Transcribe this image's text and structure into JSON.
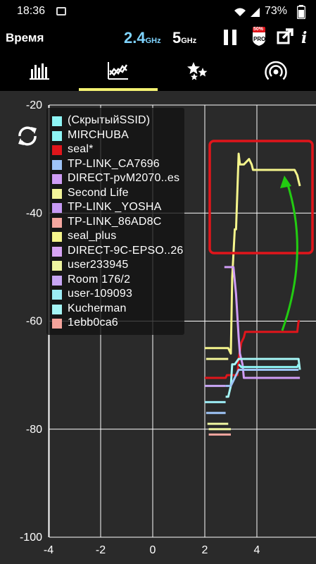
{
  "status_bar": {
    "time": "18:36",
    "battery": "73%"
  },
  "app_bar": {
    "title": "Время",
    "band_24": "2.4",
    "band_24_unit": "GHz",
    "band_5": "5",
    "band_5_unit": "GHz",
    "pro_badge": "PRO",
    "discount": "50%",
    "info": "i"
  },
  "tabs": [
    {
      "name": "channel-rating",
      "icon": "bar-chart-icon",
      "active": false
    },
    {
      "name": "time-graph",
      "icon": "time-graph-icon",
      "active": true
    },
    {
      "name": "channel-stars",
      "icon": "stars-icon",
      "active": false
    },
    {
      "name": "signal-meter",
      "icon": "signal-meter-icon",
      "active": false
    }
  ],
  "colors": {
    "accent_yellow": "#f3f171",
    "band_active": "#7fd4ff",
    "annotation_red": "#e0151b",
    "annotation_green": "#22cc11",
    "grid": "#ffffff",
    "background": "#2a2a2a"
  },
  "chart_data": {
    "type": "line",
    "xlabel": "",
    "ylabel": "",
    "xlim": [
      -4.8,
      5.8
    ],
    "ylim": [
      -100,
      -20
    ],
    "x_ticks": [
      "-4",
      "-2",
      "0",
      "2",
      "4"
    ],
    "y_ticks": [
      "-20",
      "-40",
      "-60",
      "-80",
      "-100"
    ],
    "grid": true,
    "legend_placement": "top-left",
    "legend": [
      {
        "name": "(СкрытыйSSID)",
        "color": "#8ef5f5"
      },
      {
        "name": "MIRCHUBA",
        "color": "#8ef5f5"
      },
      {
        "name": "seal*",
        "color": "#e0151b"
      },
      {
        "name": "TP-LINK_CA7696",
        "color": "#9ec4f7"
      },
      {
        "name": "DIRECT-pvM2070..es",
        "color": "#cf9cf5"
      },
      {
        "name": "Second Life",
        "color": "#f3f59a"
      },
      {
        "name": "TP-LINK _YOSHA",
        "color": "#c79af5"
      },
      {
        "name": "TP-LINK_86AD8C",
        "color": "#f5a7a0"
      },
      {
        "name": "seal_plus",
        "color": "#f5f58c"
      },
      {
        "name": "DIRECT-9C-EPSO..26",
        "color": "#d7a4f5"
      },
      {
        "name": "user233945",
        "color": "#eef5a0"
      },
      {
        "name": "Room 176/2",
        "color": "#c8a6f5"
      },
      {
        "name": "user-109093",
        "color": "#9cecf5"
      },
      {
        "name": "Kucherman",
        "color": "#a5f5f5"
      },
      {
        "name": "1ebb0ca6",
        "color": "#f5a49c"
      }
    ],
    "series": [
      {
        "color": "#f5f58c",
        "x": [
          2.0,
          2.9,
          3.0,
          3.05,
          3.15,
          3.2,
          3.3,
          3.35,
          3.5,
          3.7,
          3.8,
          3.85,
          5.0,
          5.3,
          5.45,
          5.55,
          5.6,
          5.65
        ],
        "y": [
          -65,
          -65,
          -66,
          -52,
          -43,
          -43,
          -29,
          -31,
          -31,
          -30,
          -31,
          -32,
          -32,
          -32,
          -32,
          -33,
          -34,
          -35
        ]
      },
      {
        "color": "#e0151b",
        "x": [
          2.0,
          2.8,
          2.85,
          3.25,
          3.3,
          3.4,
          3.5,
          3.55,
          3.8,
          4.2,
          5.55,
          5.6,
          5.65
        ],
        "y": [
          -70.5,
          -70.5,
          -70,
          -70,
          -67,
          -64,
          -63,
          -62,
          -62,
          -62,
          -62,
          -60,
          -60
        ]
      },
      {
        "color": "#cf9cf5",
        "x": [
          2.75,
          3.1,
          3.2,
          3.3,
          3.35,
          3.45,
          3.5,
          5.65
        ],
        "y": [
          -50,
          -50,
          -55,
          -63,
          -66,
          -68,
          -70.5,
          -70.5
        ]
      },
      {
        "color": "#a5f5f5",
        "x": [
          2.8,
          2.9,
          3.0,
          3.05,
          3.15,
          3.3,
          3.6,
          5.6,
          5.65
        ],
        "y": [
          -74,
          -74,
          -72,
          -68,
          -68,
          -67,
          -67,
          -67,
          -69
        ]
      },
      {
        "color": "#8ef5f5",
        "x": [
          3.3,
          3.4,
          3.6,
          5.55,
          5.6
        ],
        "y": [
          -68,
          -68.5,
          -68.5,
          -68.5,
          -68
        ]
      },
      {
        "color": "#9ec4f7",
        "x": [
          2.8,
          3.0,
          3.1,
          3.2,
          3.3,
          3.5,
          5.6
        ],
        "y": [
          -72,
          -72,
          -71,
          -70,
          -69,
          -69,
          -69
        ]
      },
      {
        "color": "#9cecf5",
        "x": [
          2.0,
          2.8
        ],
        "y": [
          -75,
          -75
        ]
      },
      {
        "color": "#c8a6f5",
        "x": [
          2.0,
          2.8
        ],
        "y": [
          -72,
          -72
        ]
      },
      {
        "color": "#eef5a0",
        "x": [
          2.1,
          2.9
        ],
        "y": [
          -79,
          -79
        ]
      },
      {
        "color": "#f3f59a",
        "x": [
          2.05,
          2.9
        ],
        "y": [
          -67,
          -67
        ]
      },
      {
        "color": "#9ec4f7",
        "x": [
          2.05,
          2.8
        ],
        "y": [
          -77,
          -77
        ]
      },
      {
        "color": "#f5a7a0",
        "x": [
          2.15,
          3.0
        ],
        "y": [
          -81,
          -81
        ]
      },
      {
        "color": "#eef5a0",
        "x": [
          2.15,
          3.0
        ],
        "y": [
          -80,
          -80
        ]
      }
    ]
  }
}
